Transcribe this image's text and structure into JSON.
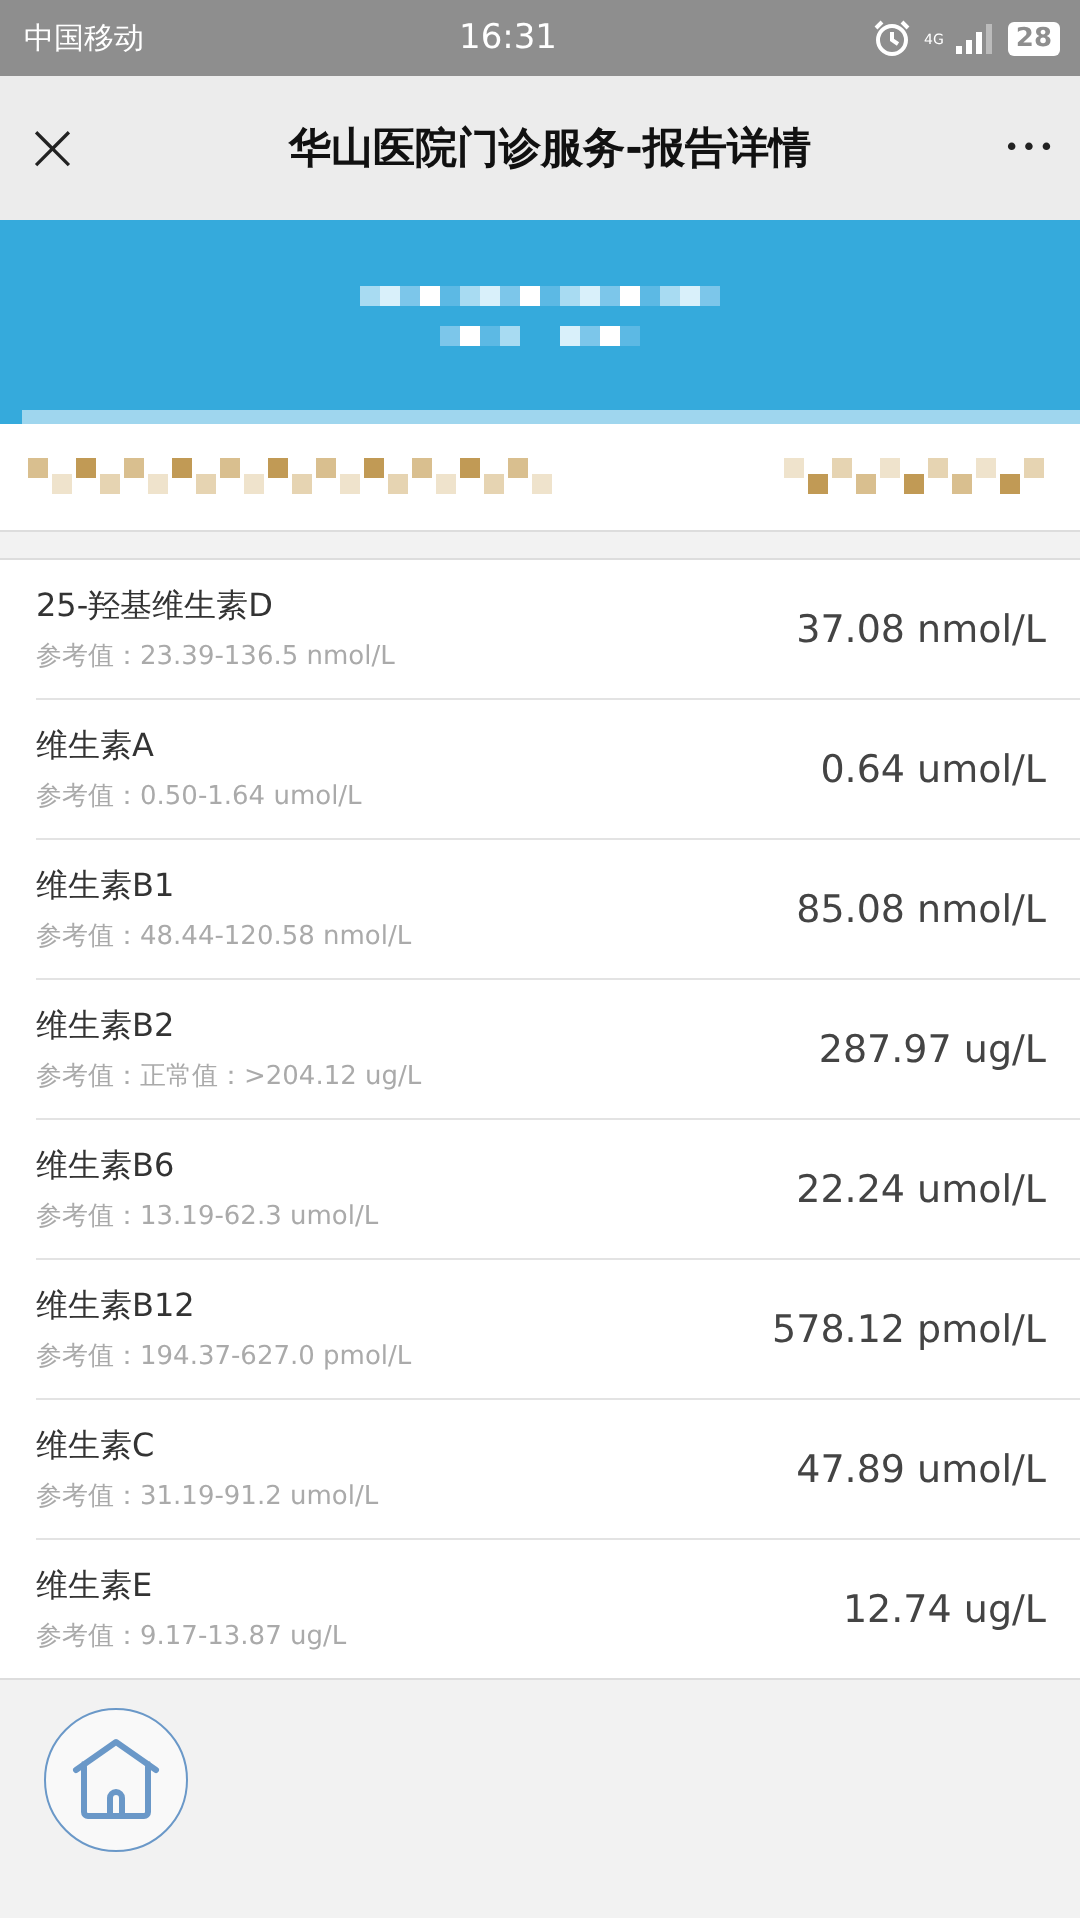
{
  "status_bar": {
    "carrier": "中国移动",
    "time": "16:31",
    "network": "4G",
    "battery": "28"
  },
  "nav": {
    "close": "×",
    "title": "华山医院门诊服务-报告详情",
    "more": "•••"
  },
  "results": [
    {
      "name": "25-羟基维生素D",
      "reference": "参考值：23.39-136.5 nmol/L",
      "value": "37.08 nmol/L"
    },
    {
      "name": "维生素A",
      "reference": "参考值：0.50-1.64 umol/L",
      "value": "0.64 umol/L"
    },
    {
      "name": "维生素B1",
      "reference": "参考值：48.44-120.58 nmol/L",
      "value": "85.08 nmol/L"
    },
    {
      "name": "维生素B2",
      "reference": "参考值：正常值：>204.12 ug/L",
      "value": "287.97 ug/L"
    },
    {
      "name": "维生素B6",
      "reference": "参考值：13.19-62.3 umol/L",
      "value": "22.24 umol/L"
    },
    {
      "name": "维生素B12",
      "reference": "参考值：194.37-627.0 pmol/L",
      "value": "578.12 pmol/L"
    },
    {
      "name": "维生素C",
      "reference": "参考值：31.19-91.2 umol/L",
      "value": "47.89 umol/L"
    },
    {
      "name": "维生素E",
      "reference": "参考值：9.17-13.87 ug/L",
      "value": "12.74 ug/L"
    }
  ]
}
